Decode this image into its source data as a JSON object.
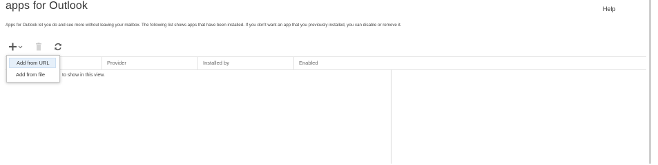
{
  "header": {
    "title": "apps for Outlook",
    "help_label": "Help"
  },
  "description": "Apps for Outlook let you do and see more without leaving your mailbox. The following list shows apps that have been installed. If you don't want an app that you previously installed, you can disable or remove it.",
  "toolbar": {
    "add_icon": "plus-icon",
    "dropdown_icon": "chevron-down-icon",
    "delete_icon": "trash-icon",
    "refresh_icon": "refresh-icon"
  },
  "grid": {
    "columns": [
      "",
      "Provider",
      "Installed by",
      "Enabled"
    ],
    "empty_message": "to show in this view."
  },
  "add_menu": {
    "items": [
      "Add from URL",
      "Add from file"
    ]
  },
  "colors": {
    "text": "#333333",
    "border": "#e3e3e3",
    "menu_hover": "#e6f0fa"
  }
}
